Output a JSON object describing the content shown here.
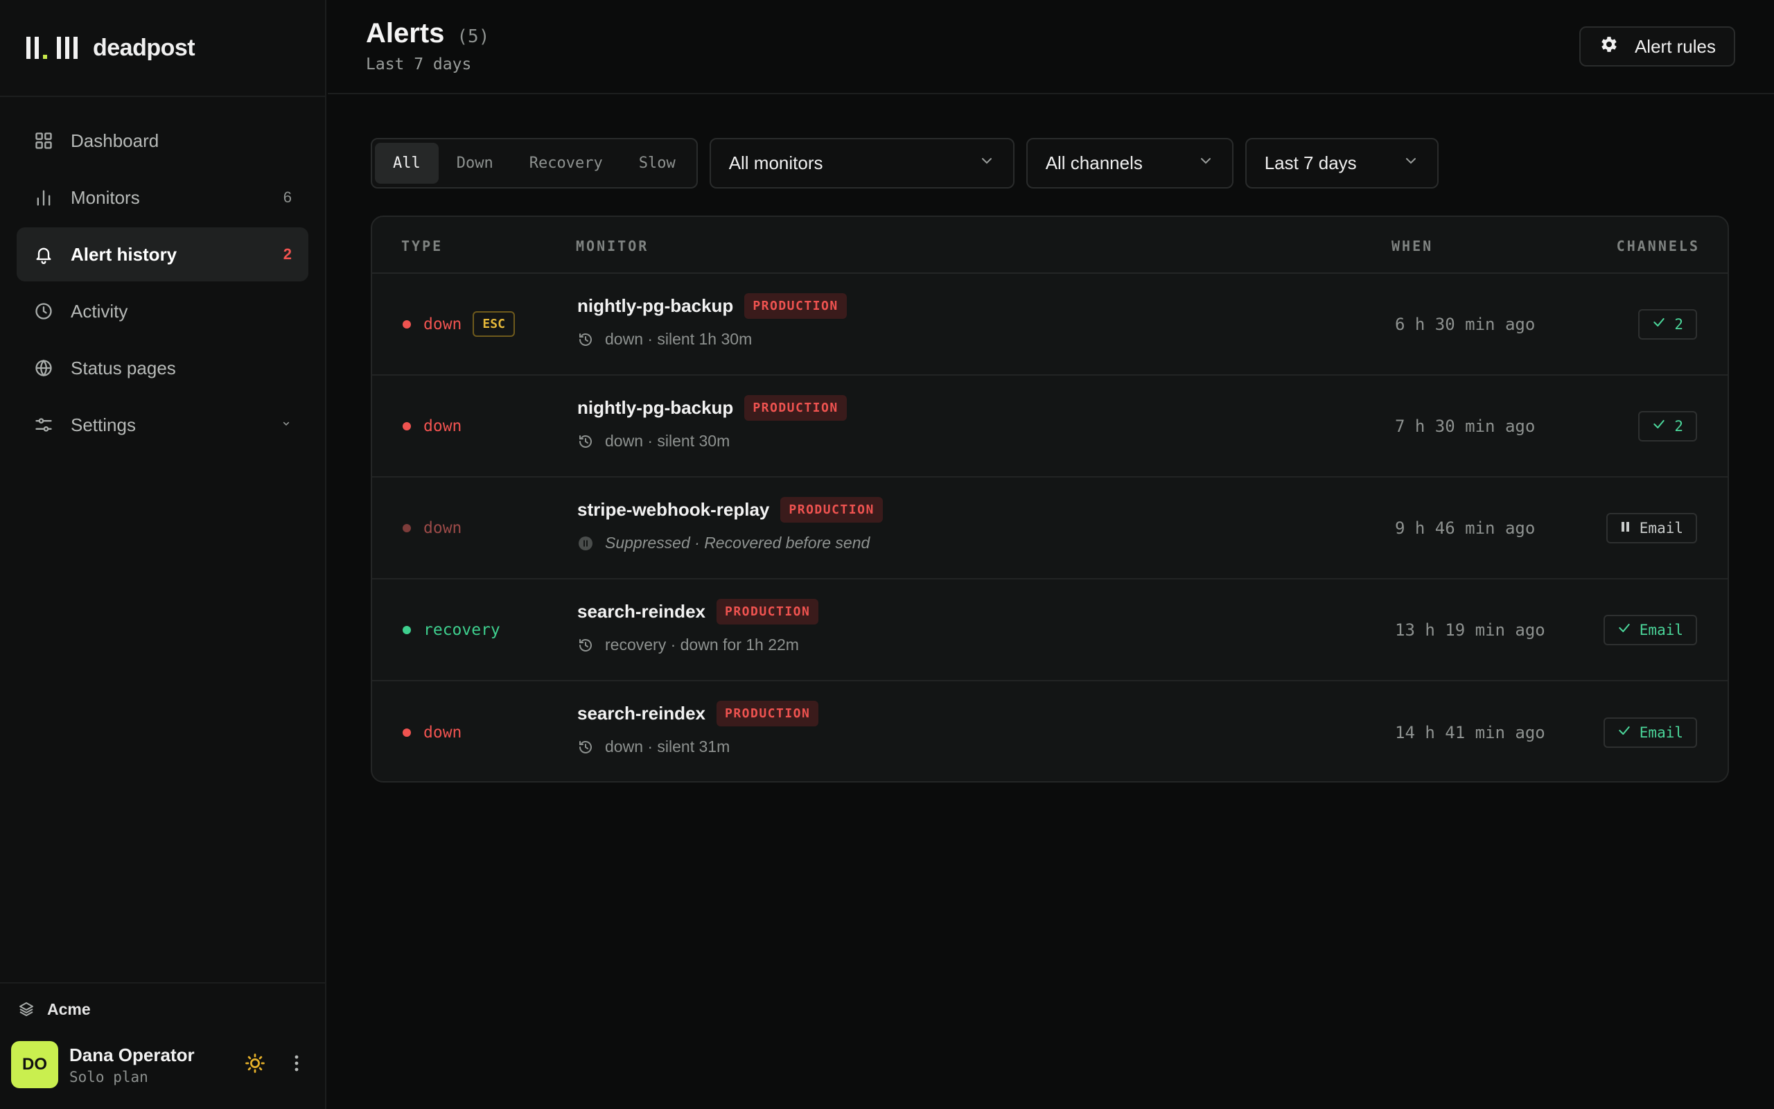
{
  "brand": {
    "name": "deadpost"
  },
  "nav": [
    {
      "label": "Dashboard",
      "icon": "grid-icon",
      "count": "",
      "active": false
    },
    {
      "label": "Monitors",
      "icon": "bar-chart-icon",
      "count": "6",
      "active": false
    },
    {
      "label": "Alert history",
      "icon": "bell-icon",
      "count": "2",
      "active": true
    },
    {
      "label": "Activity",
      "icon": "clock-icon",
      "count": "",
      "active": false
    },
    {
      "label": "Status pages",
      "icon": "globe-icon",
      "count": "",
      "active": false
    },
    {
      "label": "Settings",
      "icon": "sliders-icon",
      "count": "",
      "active": false
    }
  ],
  "org": {
    "name": "Acme"
  },
  "user": {
    "initials": "DO",
    "name": "Dana Operator",
    "plan": "Solo plan"
  },
  "header": {
    "title": "Alerts",
    "count": "(5)",
    "subtitle": "Last 7 days",
    "rules_label": "Alert rules"
  },
  "filters": {
    "segments": [
      "All",
      "Down",
      "Recovery",
      "Slow"
    ],
    "active_segment": "All",
    "monitors": "All monitors",
    "channels": "All channels",
    "range": "Last 7 days"
  },
  "table": {
    "columns": [
      "TYPE",
      "MONITOR",
      "WHEN",
      "CHANNELS"
    ],
    "rows": [
      {
        "type": "down",
        "esc": "ESC",
        "monitor": "nightly-pg-backup",
        "env": "PRODUCTION",
        "detail": "down · silent 1h 30m",
        "when": "6 h 30 min ago",
        "channel": "2",
        "channel_icon": "check-icon"
      },
      {
        "type": "down",
        "esc": "",
        "monitor": "nightly-pg-backup",
        "env": "PRODUCTION",
        "detail": "down · silent 30m",
        "when": "7 h 30 min ago",
        "channel": "2",
        "channel_icon": "check-icon"
      },
      {
        "type": "down",
        "esc": "",
        "monitor": "stripe-webhook-replay",
        "env": "PRODUCTION",
        "detail": "Suppressed · Recovered before send",
        "when": "9 h 46 min ago",
        "channel": "Email",
        "channel_icon": "pause-icon"
      },
      {
        "type": "recovery",
        "esc": "",
        "monitor": "search-reindex",
        "env": "PRODUCTION",
        "detail": "recovery · down for 1h 22m",
        "when": "13 h 19 min ago",
        "channel": "Email",
        "channel_icon": "check-icon"
      },
      {
        "type": "down",
        "esc": "",
        "monitor": "search-reindex",
        "env": "PRODUCTION",
        "detail": "down · silent 31m",
        "when": "14 h 41 min ago",
        "channel": "Email",
        "channel_icon": "check-icon"
      }
    ]
  },
  "colors": {
    "down": "#ef5350",
    "down_muted": "#9a4a48",
    "recovery": "#3ecf8e",
    "accent": "#c9ef4f",
    "esc": "#e6b93a"
  }
}
